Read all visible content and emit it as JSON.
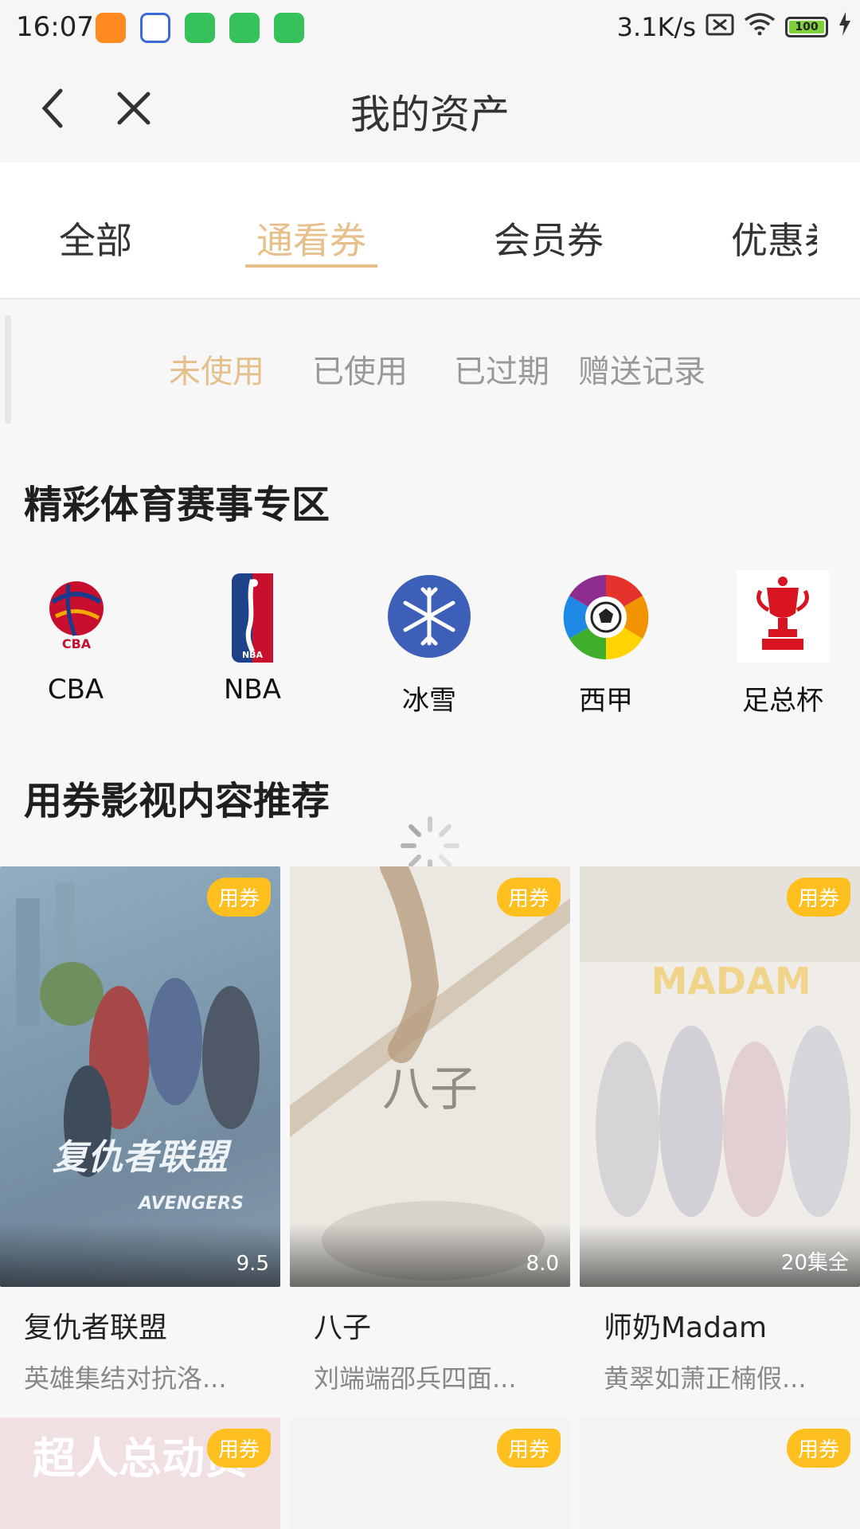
{
  "status_bar": {
    "time": "16:07",
    "speed": "3.1K/s",
    "battery": "100"
  },
  "nav": {
    "title": "我的资产"
  },
  "tabs": [
    "全部",
    "通看券",
    "会员券",
    "优惠券"
  ],
  "active_tab": "通看券",
  "subtabs": [
    "未使用",
    "已使用",
    "已过期",
    "赠送记录"
  ],
  "active_subtab": "未使用",
  "sports_section": {
    "title": "精彩体育赛事专区",
    "items": [
      {
        "label": "CBA",
        "icon": "cba-logo-icon"
      },
      {
        "label": "NBA",
        "icon": "nba-logo-icon"
      },
      {
        "label": "冰雪",
        "icon": "snowflake-icon"
      },
      {
        "label": "西甲",
        "icon": "laliga-logo-icon"
      },
      {
        "label": "足总杯",
        "icon": "fa-cup-trophy-icon"
      }
    ]
  },
  "recommend_section": {
    "title": "用券影视内容推荐",
    "badge_label": "用券",
    "cards": [
      {
        "title": "复仇者联盟",
        "subtitle": "英雄集结对抗洛...",
        "score": "9.5",
        "poster_text": "复仇者联盟"
      },
      {
        "title": "八子",
        "subtitle": "刘端端邵兵四面...",
        "score": "8.0",
        "poster_text": "八子"
      },
      {
        "title": "师奶Madam",
        "subtitle": "黄翠如萧正楠假...",
        "score": "20集全",
        "poster_text": "MADAM"
      },
      {
        "title": "",
        "subtitle": "",
        "score": "",
        "poster_text": "超人总动员"
      },
      {
        "title": "",
        "subtitle": "",
        "score": "",
        "poster_text": ""
      },
      {
        "title": "",
        "subtitle": "",
        "score": "",
        "poster_text": ""
      }
    ]
  },
  "colors": {
    "accent": "#e6c08c",
    "badge": "#ffbf1f"
  }
}
